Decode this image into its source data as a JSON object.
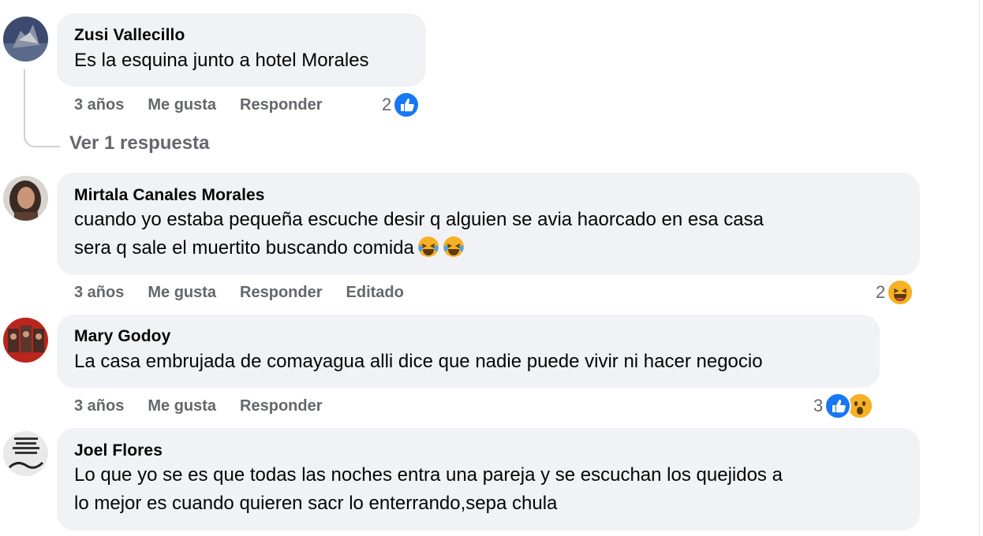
{
  "comments": [
    {
      "author": "Zusi Vallecillo",
      "text": "Es la esquina junto a hotel Morales",
      "time": "3 años",
      "like_label": "Me gusta",
      "reply_label": "Responder",
      "reaction_count": "2",
      "reactions": [
        "like-icon"
      ]
    },
    {
      "author": "Mirtala Canales Morales",
      "text_line1": "cuando yo estaba pequeña escuche desir q alguien se avia haorcado en esa casa",
      "text_line2": "sera q sale el muertito buscando comida",
      "time": "3 años",
      "like_label": "Me gusta",
      "reply_label": "Responder",
      "edited_label": "Editado",
      "reaction_count": "2",
      "reactions": [
        "haha-icon"
      ]
    },
    {
      "author": "Mary Godoy",
      "text": "La casa embrujada de comayagua alli dice que nadie puede vivir ni hacer negocio",
      "time": "3 años",
      "like_label": "Me gusta",
      "reply_label": "Responder",
      "reaction_count": "3",
      "reactions": [
        "like-icon",
        "wow-icon"
      ]
    },
    {
      "author": "Joel Flores",
      "text_line1": "Lo que yo se es que todas las noches entra una pareja y se escuchan los quejidos a",
      "text_line2": "lo mejor es cuando quieren sacr lo enterrando,sepa chula"
    }
  ],
  "view_replies_label": "Ver 1 respuesta",
  "colors": {
    "bubble": "#f0f2f5",
    "meta_text": "#65676b",
    "like_blue": "#1877f2",
    "emoji_yellow": "#f7b125"
  }
}
